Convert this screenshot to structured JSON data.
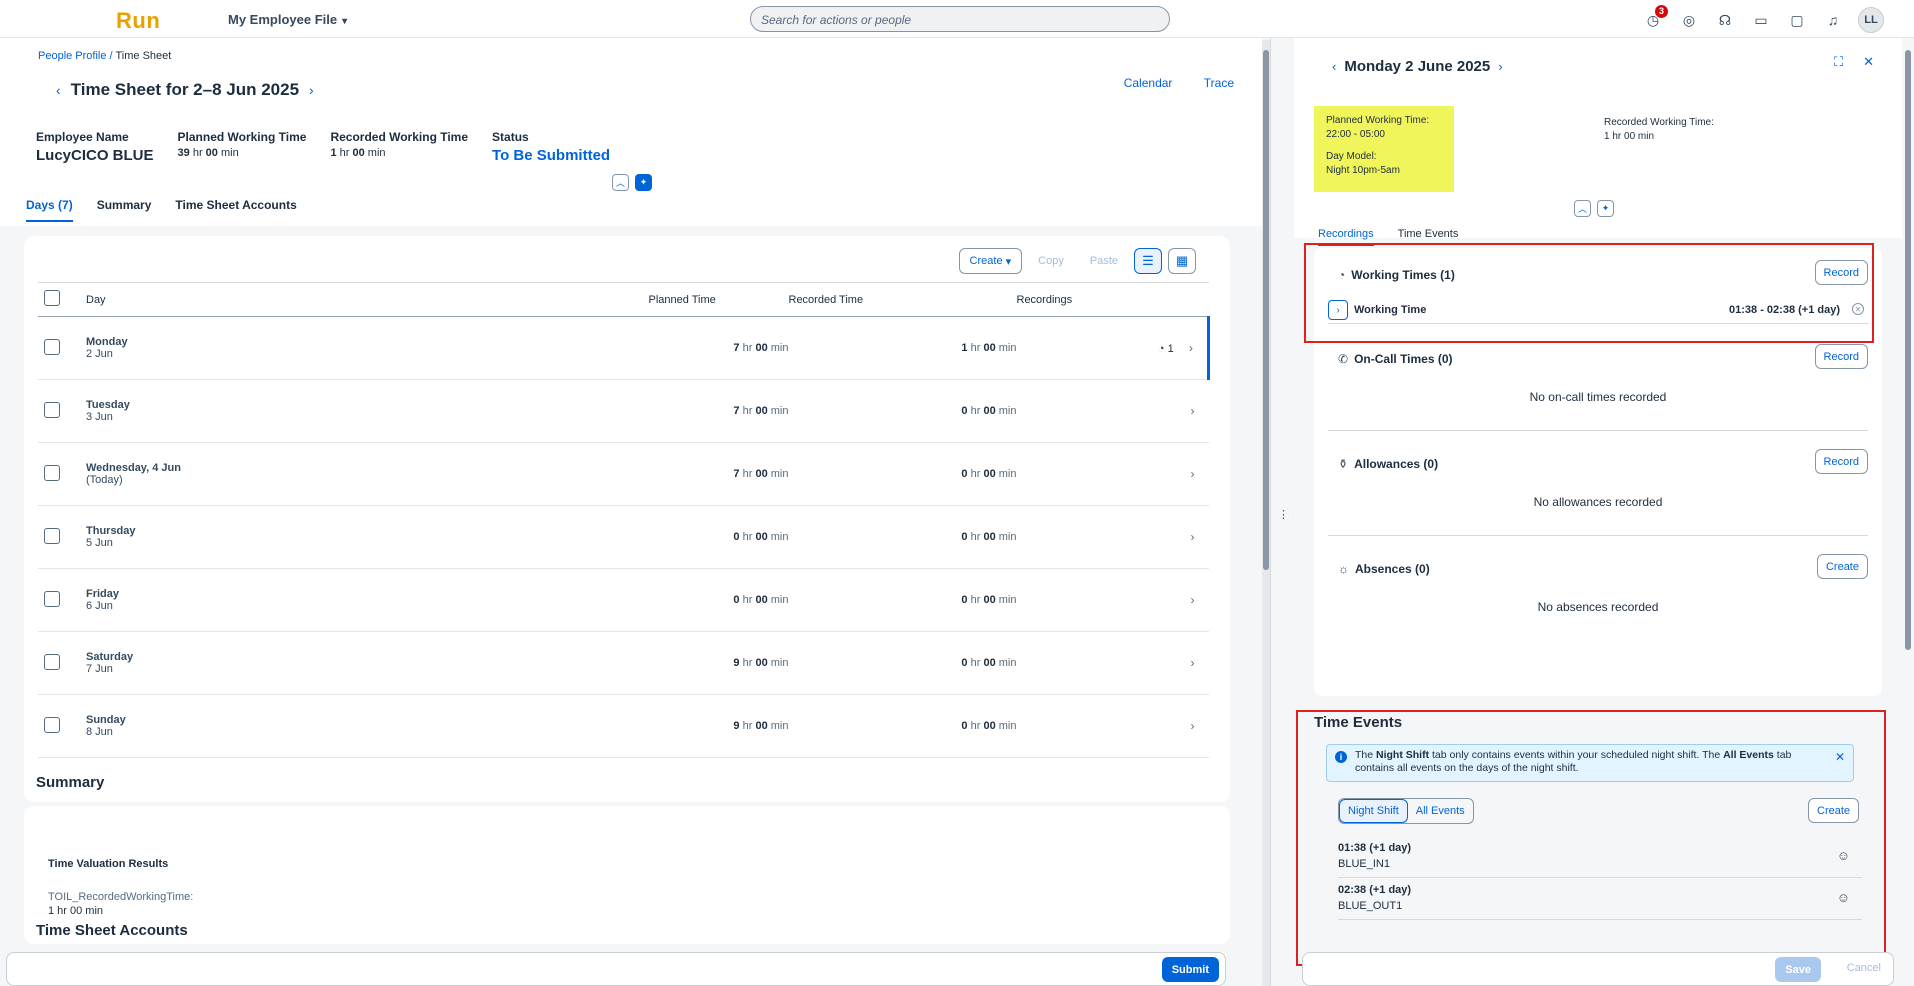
{
  "shell": {
    "logo": "Run",
    "app_title": "My Employee File",
    "search_placeholder": "Search for actions or people",
    "notifications_count": "3",
    "avatar_initials": "LL"
  },
  "breadcrumb": {
    "parent": "People Profile",
    "separator": " / ",
    "current": "Time Sheet"
  },
  "header": {
    "title": "Time Sheet for 2–8 Jun 2025",
    "calendar_link": "Calendar",
    "trace_link": "Trace",
    "employee_label": "Employee Name",
    "employee_value": "LucyCICO BLUE",
    "planned_label": "Planned Working Time",
    "planned_hr": "39",
    "planned_min": "00",
    "recorded_label": "Recorded Working Time",
    "recorded_hr": "1",
    "recorded_min": "00",
    "status_label": "Status",
    "status_value": "To Be Submitted"
  },
  "tabs": {
    "days": "Days (7)",
    "summary": "Summary",
    "accounts": "Time Sheet Accounts"
  },
  "toolbar": {
    "create": "Create",
    "copy": "Copy",
    "paste": "Paste"
  },
  "table": {
    "col_day": "Day",
    "col_planned": "Planned Time",
    "col_recorded": "Recorded Time",
    "col_recordings": "Recordings",
    "hr_unit": "hr",
    "min_unit": "min",
    "rows": [
      {
        "day": "Monday",
        "date": "2 Jun",
        "planned_hr": "7",
        "planned_min": "00",
        "recorded_hr": "1",
        "recorded_min": "00",
        "recordings": "1"
      },
      {
        "day": "Tuesday",
        "date": "3 Jun",
        "planned_hr": "7",
        "planned_min": "00",
        "recorded_hr": "0",
        "recorded_min": "00",
        "recordings": ""
      },
      {
        "day": "Wednesday, 4 Jun",
        "date": "(Today)",
        "planned_hr": "7",
        "planned_min": "00",
        "recorded_hr": "0",
        "recorded_min": "00",
        "recordings": ""
      },
      {
        "day": "Thursday",
        "date": "5 Jun",
        "planned_hr": "0",
        "planned_min": "00",
        "recorded_hr": "0",
        "recorded_min": "00",
        "recordings": ""
      },
      {
        "day": "Friday",
        "date": "6 Jun",
        "planned_hr": "0",
        "planned_min": "00",
        "recorded_hr": "0",
        "recorded_min": "00",
        "recordings": ""
      },
      {
        "day": "Saturday",
        "date": "7 Jun",
        "planned_hr": "9",
        "planned_min": "00",
        "recorded_hr": "0",
        "recorded_min": "00",
        "recordings": ""
      },
      {
        "day": "Sunday",
        "date": "8 Jun",
        "planned_hr": "9",
        "planned_min": "00",
        "recorded_hr": "0",
        "recorded_min": "00",
        "recordings": ""
      }
    ]
  },
  "summary": {
    "title": "Summary",
    "results_title": "Time Valuation Results",
    "result_key": "TOIL_RecordedWorkingTime:",
    "result_value": "1 hr 00 min",
    "accounts_title": "Time Sheet Accounts",
    "submit": "Submit"
  },
  "detail": {
    "title": "Monday 2 June 2025",
    "planned_label": "Planned Working Time:",
    "planned_value": "22:00 - 05:00",
    "day_model_label": "Day Model:",
    "day_model_value": "Night 10pm-5am",
    "recorded_label": "Recorded Working Time:",
    "recorded_value": "1 hr 00 min",
    "tab_recordings": "Recordings",
    "tab_time_events": "Time Events",
    "working_times_title": "Working Times (1)",
    "working_time_label": "Working Time",
    "working_time_value": "01:38 - 02:38 (+1 day)",
    "on_call_title": "On-Call Times (0)",
    "on_call_empty": "No on-call times recorded",
    "allowances_title": "Allowances (0)",
    "allowances_empty": "No allowances recorded",
    "absences_title": "Absences (0)",
    "absences_empty": "No absences recorded",
    "record": "Record",
    "create": "Create",
    "time_events_title": "Time Events",
    "info_1": "The ",
    "info_night": "Night Shift",
    "info_2": " tab only contains events within your scheduled night shift. The ",
    "info_all": "All Events",
    "info_3": " tab contains all events on the days of the night shift.",
    "seg_night": "Night Shift",
    "seg_all": "All Events",
    "events": [
      {
        "time": "01:38 (+1 day)",
        "name": "BLUE_IN1"
      },
      {
        "time": "02:38 (+1 day)",
        "name": "BLUE_OUT1"
      }
    ],
    "save": "Save",
    "cancel": "Cancel"
  }
}
